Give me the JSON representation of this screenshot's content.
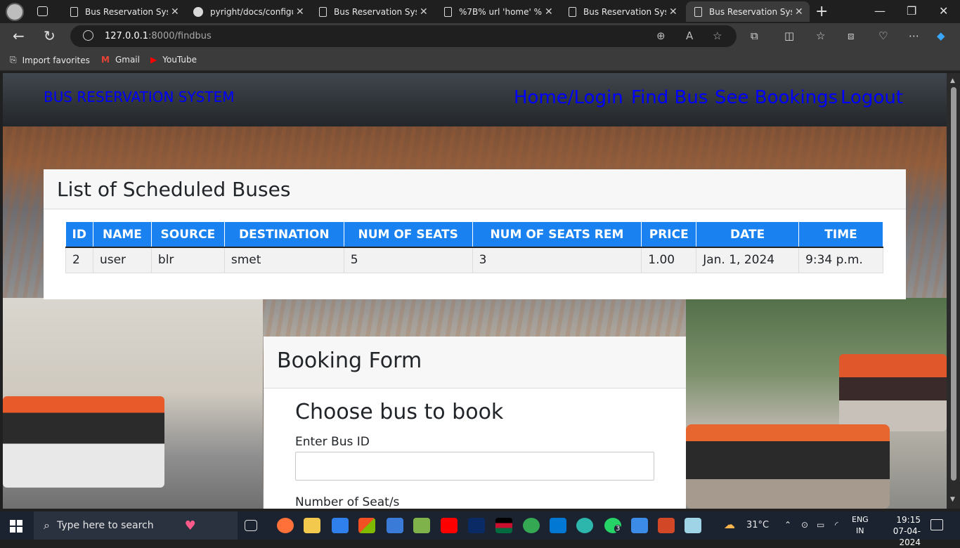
{
  "browser": {
    "tabs": [
      {
        "title": "Bus Reservation Syste",
        "icon": "page-icon",
        "active": false
      },
      {
        "title": "pyright/docs/configu",
        "icon": "github-icon",
        "active": false
      },
      {
        "title": "Bus Reservation Syste",
        "icon": "page-icon",
        "active": false
      },
      {
        "title": "%7B% url 'home' %%",
        "icon": "page-icon",
        "active": false
      },
      {
        "title": "Bus Reservation Syste",
        "icon": "page-icon",
        "active": false
      },
      {
        "title": "Bus Reservation Syste",
        "icon": "page-icon",
        "active": true
      }
    ],
    "url_host": "127.0.0.1",
    "url_rest": ":8000/findbus",
    "favorites": [
      {
        "label": "Import favorites",
        "icon": "import-icon"
      },
      {
        "label": "Gmail",
        "icon": "gmail-icon"
      },
      {
        "label": "YouTube",
        "icon": "youtube-icon"
      }
    ]
  },
  "site": {
    "brand": "BUS RESERVATION SYSTEM",
    "nav": [
      "Home/Login",
      "Find Bus",
      "See Bookings",
      "Logout"
    ],
    "link_color": "#0000ff"
  },
  "buses_card": {
    "title": "List of Scheduled Buses",
    "columns": [
      "ID",
      "NAME",
      "SOURCE",
      "DESTINATION",
      "NUM OF SEATS",
      "NUM OF SEATS REM",
      "PRICE",
      "DATE",
      "TIME"
    ],
    "rows": [
      [
        "2",
        "user",
        "blr",
        "smet",
        "5",
        "3",
        "1.00",
        "Jan. 1, 2024",
        "9:34 p.m."
      ]
    ],
    "header_color": "#1a82f0"
  },
  "booking_card": {
    "title": "Booking Form",
    "subtitle": "Choose bus to book",
    "bus_id_label": "Enter Bus ID",
    "bus_id_value": "",
    "seats_label": "Number of Seat/s"
  },
  "taskbar": {
    "search_placeholder": "Type here to search",
    "weather": "31°C",
    "lang_top": "ENG",
    "lang_bottom": "IN",
    "time": "19:15",
    "date": "07-04-2024",
    "badge": "3"
  }
}
